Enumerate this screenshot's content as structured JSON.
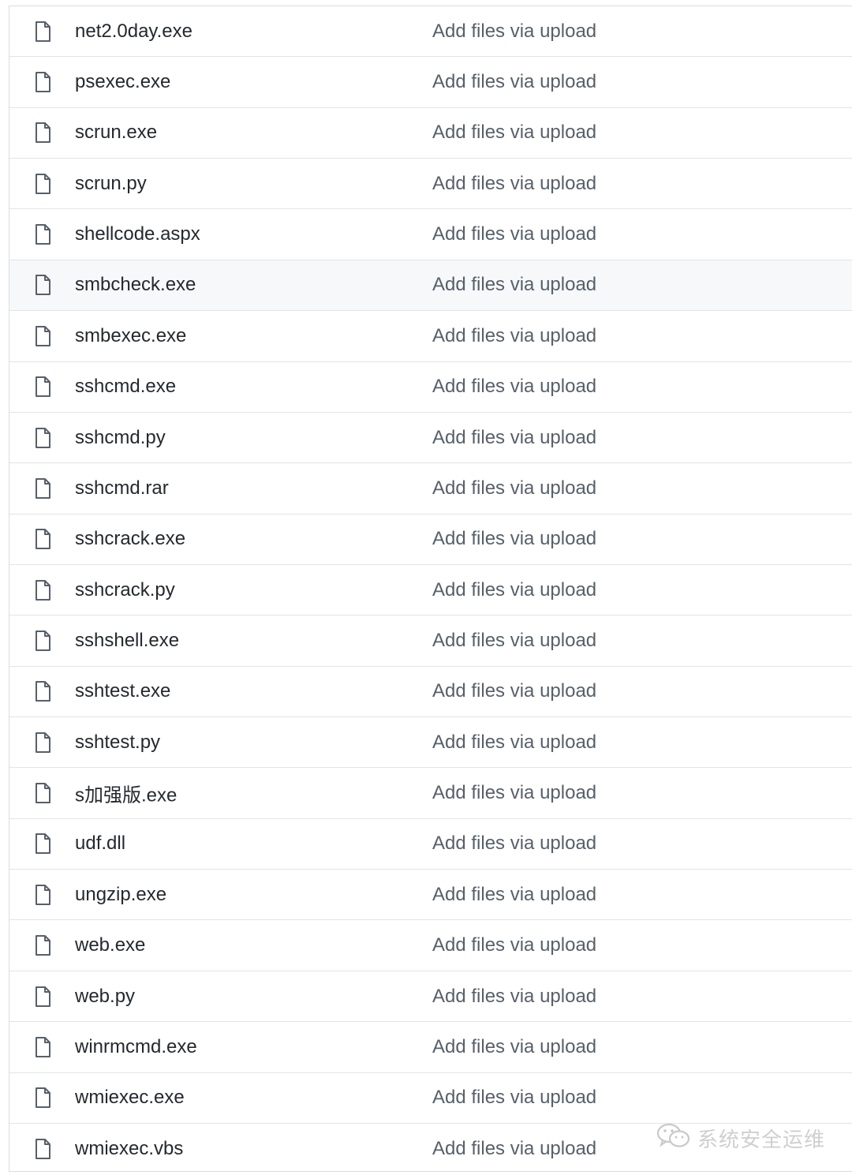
{
  "files": [
    {
      "name": "net2.0day.exe",
      "message": "Add files via upload",
      "icon": "file-icon"
    },
    {
      "name": "psexec.exe",
      "message": "Add files via upload",
      "icon": "file-icon"
    },
    {
      "name": "scrun.exe",
      "message": "Add files via upload",
      "icon": "file-icon"
    },
    {
      "name": "scrun.py",
      "message": "Add files via upload",
      "icon": "file-icon"
    },
    {
      "name": "shellcode.aspx",
      "message": "Add files via upload",
      "icon": "file-icon"
    },
    {
      "name": "smbcheck.exe",
      "message": "Add files via upload",
      "icon": "file-icon",
      "highlighted": true
    },
    {
      "name": "smbexec.exe",
      "message": "Add files via upload",
      "icon": "file-icon"
    },
    {
      "name": "sshcmd.exe",
      "message": "Add files via upload",
      "icon": "file-icon"
    },
    {
      "name": "sshcmd.py",
      "message": "Add files via upload",
      "icon": "file-icon"
    },
    {
      "name": "sshcmd.rar",
      "message": "Add files via upload",
      "icon": "file-icon"
    },
    {
      "name": "sshcrack.exe",
      "message": "Add files via upload",
      "icon": "file-icon"
    },
    {
      "name": "sshcrack.py",
      "message": "Add files via upload",
      "icon": "file-icon"
    },
    {
      "name": "sshshell.exe",
      "message": "Add files via upload",
      "icon": "file-icon"
    },
    {
      "name": "sshtest.exe",
      "message": "Add files via upload",
      "icon": "file-icon"
    },
    {
      "name": "sshtest.py",
      "message": "Add files via upload",
      "icon": "file-icon"
    },
    {
      "name": "s加强版.exe",
      "message": "Add files via upload",
      "icon": "file-icon"
    },
    {
      "name": "udf.dll",
      "message": "Add files via upload",
      "icon": "file-icon"
    },
    {
      "name": "ungzip.exe",
      "message": "Add files via upload",
      "icon": "file-icon"
    },
    {
      "name": "web.exe",
      "message": "Add files via upload",
      "icon": "file-icon"
    },
    {
      "name": "web.py",
      "message": "Add files via upload",
      "icon": "file-icon"
    },
    {
      "name": "winrmcmd.exe",
      "message": "Add files via upload",
      "icon": "file-icon"
    },
    {
      "name": "wmiexec.exe",
      "message": "Add files via upload",
      "icon": "file-icon"
    },
    {
      "name": "wmiexec.vbs",
      "message": "Add files via upload",
      "icon": "file-icon"
    }
  ],
  "watermark": {
    "text": "系统安全运维",
    "icon": "wechat-icon"
  },
  "colors": {
    "file_name": "#24292f",
    "commit_message": "#57606a",
    "icon_stroke": "#57606a",
    "row_border": "#e1e4e8",
    "hover_background": "#f6f8fa"
  }
}
